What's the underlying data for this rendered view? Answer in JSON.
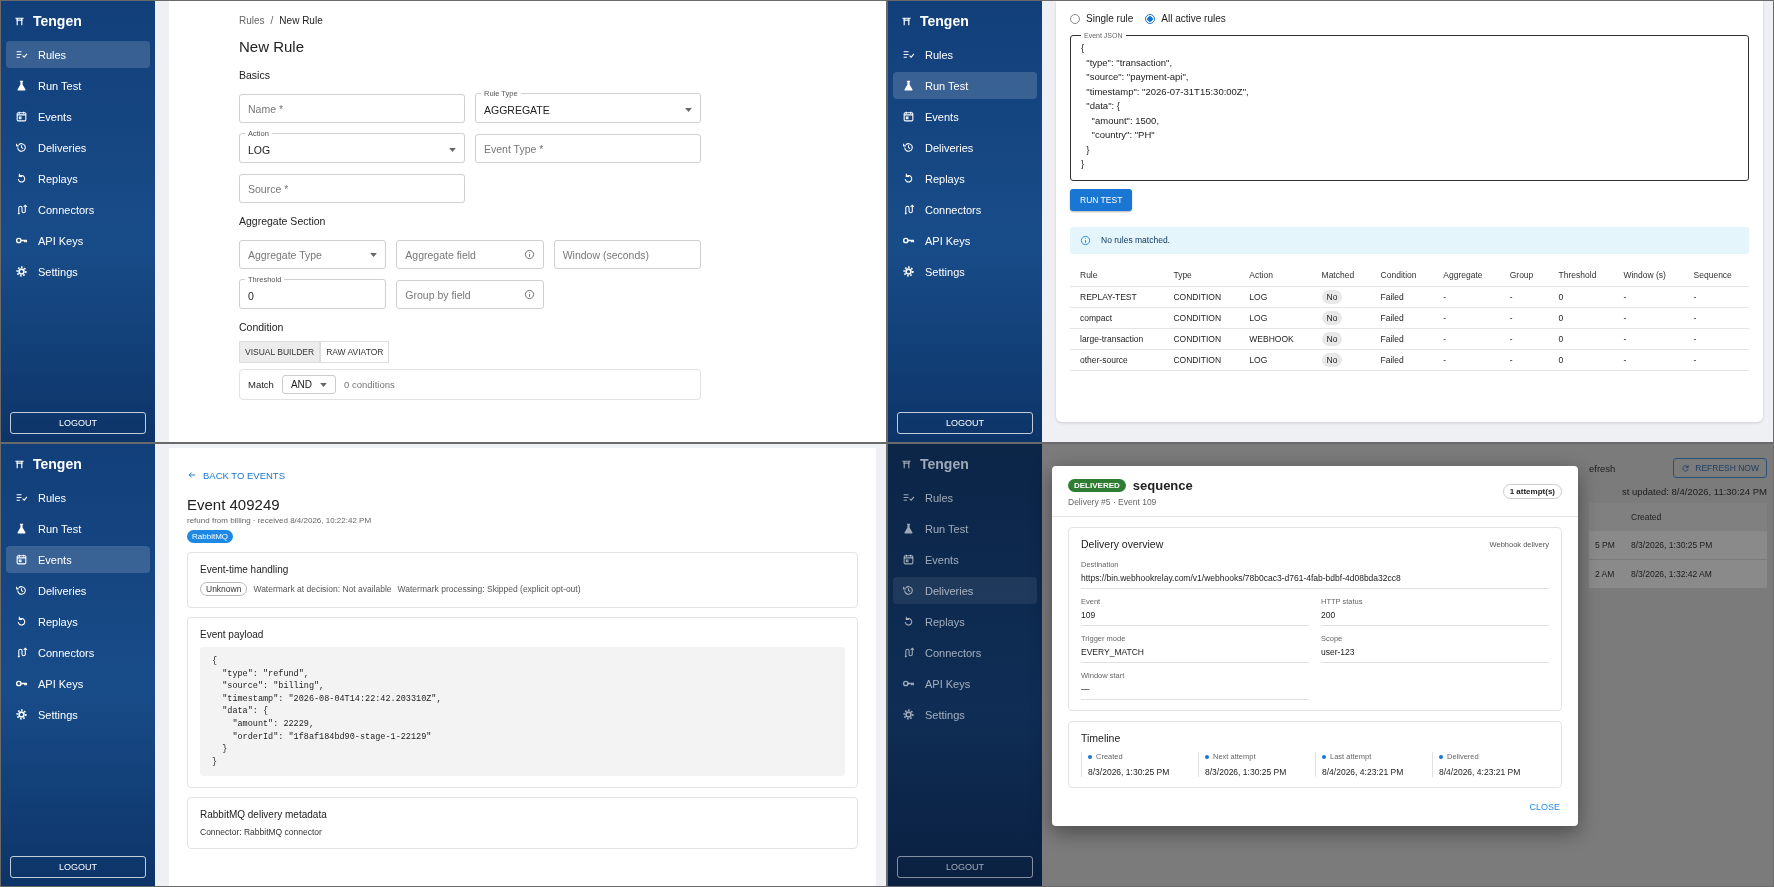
{
  "panels": [
    {
      "kind": "rule-form",
      "sidebar": {
        "brand": "Tengen",
        "logout": "LOGOUT",
        "items": [
          {
            "label": "Rules",
            "selected": true
          },
          {
            "label": "Run Test",
            "selected": false
          },
          {
            "label": "Events",
            "selected": false
          },
          {
            "label": "Deliveries",
            "selected": false
          },
          {
            "label": "Replays",
            "selected": false
          },
          {
            "label": "Connectors",
            "selected": false
          },
          {
            "label": "API Keys",
            "selected": false
          },
          {
            "label": "Settings",
            "selected": false
          }
        ]
      },
      "breadcrumb": {
        "separator": "/",
        "items": [
          "Rules",
          "New Rule"
        ]
      },
      "title": "New Rule",
      "sections": [
        {
          "heading": "Basics",
          "kind": "pairs",
          "fields": [
            {
              "kind": "text",
              "placeholder": "Name *"
            },
            {
              "kind": "select",
              "label": "Rule Type",
              "value": "AGGREGATE"
            },
            {
              "kind": "select",
              "label": "Action",
              "value": "LOG"
            },
            {
              "kind": "text",
              "placeholder": "Event Type *"
            },
            {
              "kind": "text",
              "placeholder": "Source *"
            }
          ]
        },
        {
          "heading": "Aggregate Section",
          "kind": "triples",
          "fields": [
            {
              "kind": "select",
              "placeholder": "Aggregate Type"
            },
            {
              "kind": "info",
              "placeholder": "Aggregate field"
            },
            {
              "kind": "text",
              "placeholder": "Window (seconds)"
            },
            {
              "kind": "text",
              "label": "Threshold",
              "value": "0"
            },
            {
              "kind": "info",
              "placeholder": "Group by field"
            }
          ]
        }
      ],
      "condition": {
        "heading": "Condition",
        "modes": [
          {
            "label": "VISUAL BUILDER",
            "selected": true
          },
          {
            "label": "RAW AVIATOR",
            "selected": false
          }
        ],
        "match": {
          "label": "Match",
          "value": "AND",
          "count": "0 conditions"
        }
      }
    },
    {
      "kind": "run-test",
      "sidebar": {
        "brand": "Tengen",
        "logout": "LOGOUT",
        "items": [
          {
            "label": "Rules",
            "selected": false
          },
          {
            "label": "Run Test",
            "selected": true
          },
          {
            "label": "Events",
            "selected": false
          },
          {
            "label": "Deliveries",
            "selected": false
          },
          {
            "label": "Replays",
            "selected": false
          },
          {
            "label": "Connectors",
            "selected": false
          },
          {
            "label": "API Keys",
            "selected": false
          },
          {
            "label": "Settings",
            "selected": false
          }
        ]
      },
      "scope": [
        {
          "label": "Single rule",
          "selected": false
        },
        {
          "label": "All active rules",
          "selected": true
        }
      ],
      "editor": {
        "label": "Event JSON",
        "value": "{\n  \"type\": \"transaction\",\n  \"source\": \"payment-api\",\n  \"timestamp\": \"2026-07-31T15:30:00Z\",\n  \"data\": {\n    \"amount\": 1500,\n    \"country\": \"PH\"\n  }\n}"
      },
      "run_button": "RUN TEST",
      "alert": "No rules matched.",
      "table": {
        "columns": [
          {
            "label": "Rule",
            "kind": "text"
          },
          {
            "label": "Type",
            "kind": "text"
          },
          {
            "label": "Action",
            "kind": "text"
          },
          {
            "label": "Matched",
            "kind": "chip"
          },
          {
            "label": "Condition",
            "kind": "text"
          },
          {
            "label": "Aggregate",
            "kind": "text"
          },
          {
            "label": "Group",
            "kind": "text"
          },
          {
            "label": "Threshold",
            "kind": "text"
          },
          {
            "label": "Window (s)",
            "kind": "text"
          },
          {
            "label": "Sequence",
            "kind": "text"
          }
        ],
        "rows": [
          [
            "REPLAY-TEST",
            "CONDITION",
            "LOG",
            "No",
            "Failed",
            "-",
            "-",
            "0",
            "-",
            "-"
          ],
          [
            "compact",
            "CONDITION",
            "LOG",
            "No",
            "Failed",
            "-",
            "-",
            "0",
            "-",
            "-"
          ],
          [
            "large-transaction",
            "CONDITION",
            "WEBHOOK",
            "No",
            "Failed",
            "-",
            "-",
            "0",
            "-",
            "-"
          ],
          [
            "other-source",
            "CONDITION",
            "LOG",
            "No",
            "Failed",
            "-",
            "-",
            "0",
            "-",
            "-"
          ]
        ]
      }
    },
    {
      "kind": "event-detail",
      "sidebar": {
        "brand": "Tengen",
        "logout": "LOGOUT",
        "items": [
          {
            "label": "Rules",
            "selected": false
          },
          {
            "label": "Run Test",
            "selected": false
          },
          {
            "label": "Events",
            "selected": true
          },
          {
            "label": "Deliveries",
            "selected": false
          },
          {
            "label": "Replays",
            "selected": false
          },
          {
            "label": "Connectors",
            "selected": false
          },
          {
            "label": "API Keys",
            "selected": false
          },
          {
            "label": "Settings",
            "selected": false
          }
        ]
      },
      "back": "BACK TO EVENTS",
      "title": "Event 409249",
      "subtitle": "refund from billing · received 8/4/2026, 10:22:42 PM",
      "badge": "RabbitMQ",
      "cards": [
        {
          "kind": "handling",
          "title": "Event-time handling",
          "chip": "Unknown",
          "notes": [
            "Watermark at decision: Not available",
            "Watermark processing: Skipped (explicit opt-out)"
          ]
        },
        {
          "kind": "code",
          "title": "Event payload",
          "code": "{\n  \"type\": \"refund\",\n  \"source\": \"billing\",\n  \"timestamp\": \"2026-08-04T14:22:42.203310Z\",\n  \"data\": {\n    \"amount\": 22229,\n    \"orderId\": \"1f8af184bd90-stage-1-22129\"\n  }\n}"
        },
        {
          "kind": "lines",
          "title": "RabbitMQ delivery metadata",
          "lines": [
            "Connector: RabbitMQ connector"
          ]
        }
      ]
    },
    {
      "kind": "delivery-modal",
      "sidebar": {
        "brand": "Tengen",
        "logout": "LOGOUT",
        "items": [
          {
            "label": "Rules",
            "selected": false
          },
          {
            "label": "Run Test",
            "selected": false
          },
          {
            "label": "Events",
            "selected": false
          },
          {
            "label": "Deliveries",
            "selected": true
          },
          {
            "label": "Replays",
            "selected": false
          },
          {
            "label": "Connectors",
            "selected": false
          },
          {
            "label": "API Keys",
            "selected": false
          },
          {
            "label": "Settings",
            "selected": false
          }
        ]
      },
      "background": {
        "refresh_label": "efresh",
        "refresh_button": "REFRESH NOW",
        "updated": "st updated: 8/4/2026, 11:30:24 PM",
        "header": "Created",
        "rows": [
          {
            "column_1": "5 PM",
            "created": "8/3/2026, 1:30:25 PM"
          },
          {
            "column_1": "2 AM",
            "created": "8/3/2026, 1:32:42 AM"
          }
        ]
      },
      "modal": {
        "status": "DELIVERED",
        "title": "sequence",
        "subtitle": "Delivery #5 · Event 109",
        "attempts": "1 attempt(s)",
        "overview": {
          "title": "Delivery overview",
          "tag": "Webhook delivery",
          "fields": [
            {
              "kind": "wide",
              "label": "Destination",
              "value": "https://bin.webhookrelay.com/v1/webhooks/78b0cac3-d761-4fab-bdbf-4d08bda32cc8"
            },
            {
              "kind": "half",
              "label": "Event",
              "value": "109"
            },
            {
              "kind": "half",
              "label": "HTTP status",
              "value": "200"
            },
            {
              "kind": "half",
              "label": "Trigger mode",
              "value": "EVERY_MATCH"
            },
            {
              "kind": "half",
              "label": "Scope",
              "value": "user-123"
            },
            {
              "kind": "half",
              "label": "Window start",
              "value": "—"
            }
          ]
        },
        "timeline": {
          "title": "Timeline",
          "steps": [
            {
              "label": "Created",
              "value": "8/3/2026, 1:30:25 PM"
            },
            {
              "label": "Next attempt",
              "value": "8/3/2026, 1:30:25 PM"
            },
            {
              "label": "Last attempt",
              "value": "8/4/2026, 4:23:21 PM"
            },
            {
              "label": "Delivered",
              "value": "8/4/2026, 4:23:21 PM"
            }
          ]
        },
        "close": "CLOSE"
      }
    }
  ]
}
